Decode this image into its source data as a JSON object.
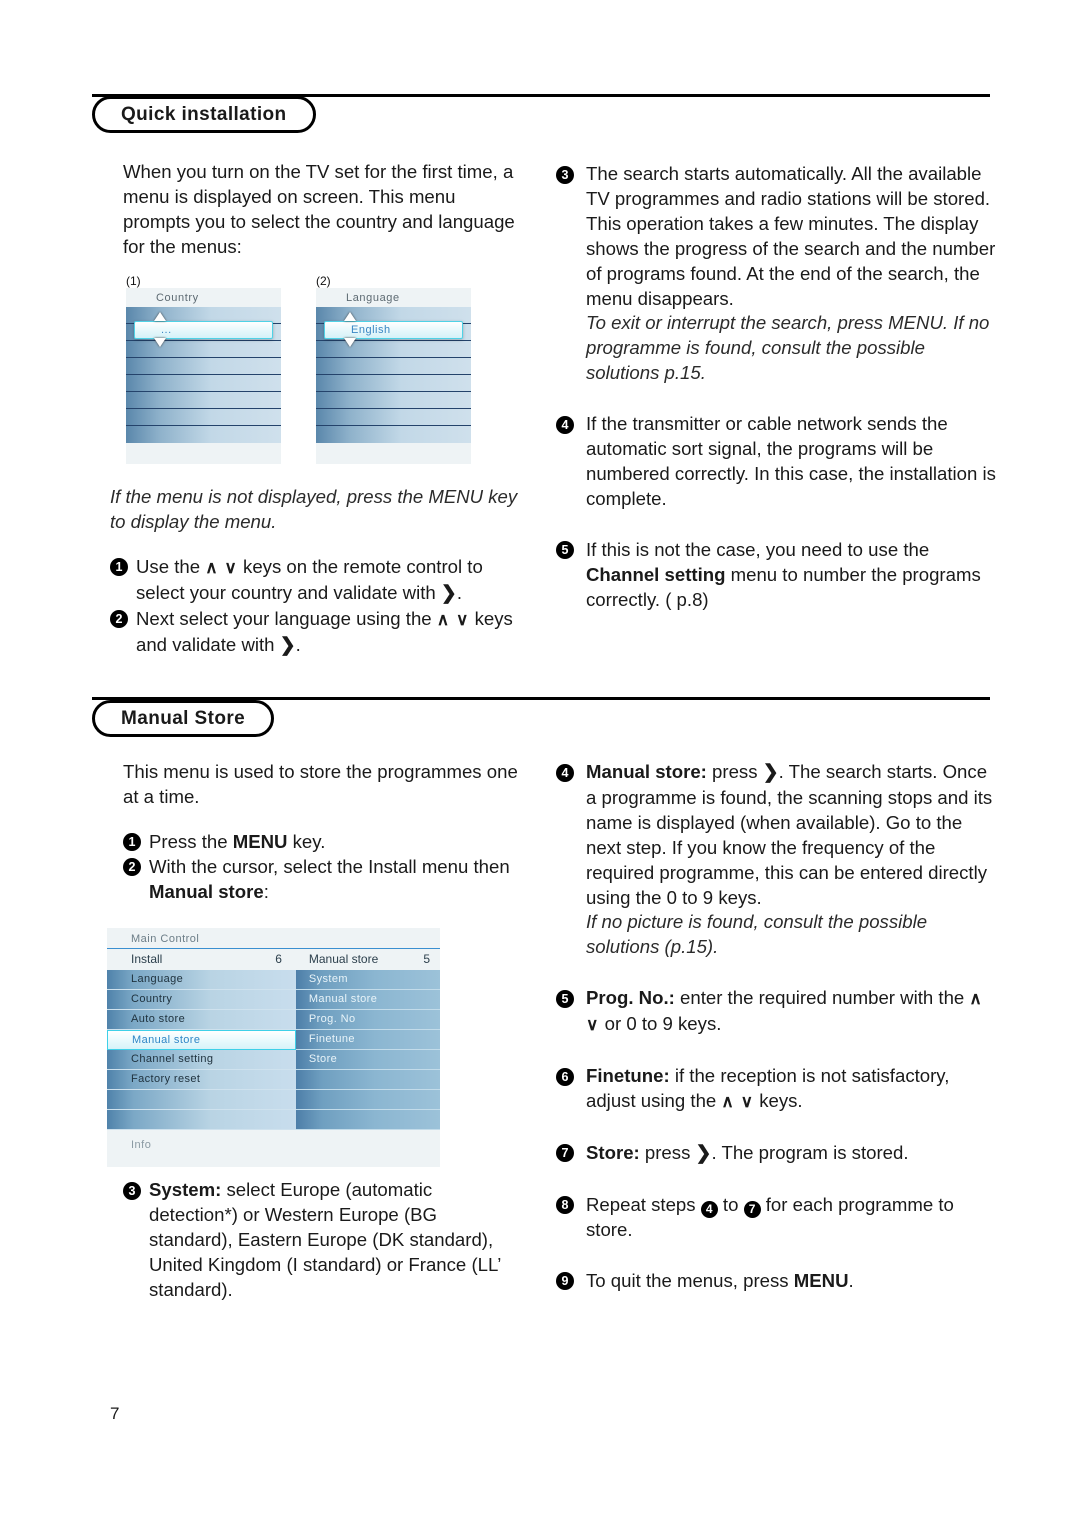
{
  "page": {
    "number": "7"
  },
  "sections": [
    {
      "id": "quick-installation",
      "title": "Quick installation"
    },
    {
      "id": "manual-store",
      "title": "Manual Store"
    }
  ],
  "quick_installation": {
    "intro": "When you turn on the TV set for the first time, a menu is displayed on screen. This menu prompts you to select the country and language for the menus:",
    "note_menu": "If the menu is not displayed, press the MENU key to display the menu.",
    "steps": [
      {
        "num": "1",
        "text_before": "Use the ",
        "keys": "∧ ∨",
        "text_mid": " keys on the remote control to select your country and validate with ",
        "key_right": "❯",
        "text_after": "."
      },
      {
        "num": "2",
        "text_before": "Next select your language using the ",
        "keys": "∧ ∨",
        "text_mid": " keys and validate with ",
        "key_right": "❯",
        "text_after": "."
      }
    ],
    "right_steps": [
      {
        "num": "3",
        "text": "The search starts automatically. All the available TV programmes and radio stations will be stored. This operation takes a few minutes. The display shows the progress of the search and the number of programs found. At the end of the search, the menu disappears.",
        "note": "To exit or interrupt the search, press MENU. If no programme is found, consult the possible solutions p.15."
      },
      {
        "num": "4",
        "text": "If the transmitter or cable network sends the automatic sort signal, the programs will be numbered correctly. In this case, the installation is complete."
      },
      {
        "num": "5",
        "text_before": "If this is not the case, you need to use the ",
        "bold": "Channel setting",
        "text_after": " menu to number the programs correctly. ( p.8)"
      }
    ],
    "screens": [
      {
        "label": "(1)",
        "title": "Country",
        "selected_value": "...",
        "up_arrow": "▲",
        "down_arrow": "▼"
      },
      {
        "label": "(2)",
        "title": "Language",
        "selected_value": "English",
        "up_arrow": "▲",
        "down_arrow": "▼"
      }
    ]
  },
  "manual_store": {
    "intro": "This menu is used to store the programmes one at a time.",
    "steps_left": [
      {
        "num": "1",
        "text_before": "Press the ",
        "bold": "MENU",
        "text_after": " key."
      },
      {
        "num": "2",
        "text_before": "With the cursor, select the Install menu then ",
        "bold": "Manual store",
        "text_after": ":"
      },
      {
        "num": "3",
        "bold": "System:",
        "text_after": " select Europe (automatic detection*) or Western Europe (BG standard), Eastern Europe (DK standard), United Kingdom (I standard) or France (LL’ standard)."
      }
    ],
    "steps_right": [
      {
        "num": "4",
        "bold": "Manual store:",
        "text_before": " press ",
        "key_right": "❯",
        "text_after": ". The search starts. Once a programme is found, the scanning stops and its name is displayed (when available). Go to the next step. If you know the frequency of the required programme, this can be entered directly using the 0 to 9 keys.",
        "note": "If no picture is found, consult the possible solutions (p.15)."
      },
      {
        "num": "5",
        "bold": "Prog. No.:",
        "text_before": " enter the required number with the ",
        "keys": "∧ ∨",
        "text_after": " or 0 to 9 keys."
      },
      {
        "num": "6",
        "bold": "Finetune:",
        "text_before": " if the reception is not satisfactory, adjust using the ",
        "keys": "∧ ∨",
        "text_after": " keys."
      },
      {
        "num": "7",
        "bold": "Store:",
        "text_before": " press ",
        "key_right": "❯",
        "text_after": ". The program is stored."
      },
      {
        "num": "8",
        "text_before": "Repeat steps ",
        "ref_a": "4",
        "text_mid": " to ",
        "ref_b": "7",
        "text_after": " for each programme to store."
      },
      {
        "num": "9",
        "text_before": "To quit the menus, press ",
        "bold": "MENU",
        "text_after": "."
      }
    ],
    "screen": {
      "main_label": "Main Control",
      "left_header": {
        "label": "Install",
        "count": "6"
      },
      "right_header": {
        "label": "Manual store",
        "count": "5"
      },
      "left_items": [
        {
          "label": "Language",
          "selected": false
        },
        {
          "label": "Country",
          "selected": false
        },
        {
          "label": "Auto store",
          "selected": false
        },
        {
          "label": "Manual store",
          "selected": true
        },
        {
          "label": "Channel setting",
          "selected": false
        },
        {
          "label": "Factory reset",
          "selected": false
        },
        {
          "label": "",
          "selected": false
        },
        {
          "label": "",
          "selected": false
        }
      ],
      "right_items": [
        {
          "label": "System"
        },
        {
          "label": "Manual store"
        },
        {
          "label": "Prog. No"
        },
        {
          "label": "Finetune"
        },
        {
          "label": "Store"
        },
        {
          "label": ""
        },
        {
          "label": ""
        },
        {
          "label": ""
        }
      ],
      "info_label": "Info"
    }
  },
  "colors": {
    "accent_cyan": "#4fd2e6",
    "osd_blue_dark": "#4f82aa",
    "osd_blue_light": "#c8dded",
    "rule_black": "#000000"
  }
}
